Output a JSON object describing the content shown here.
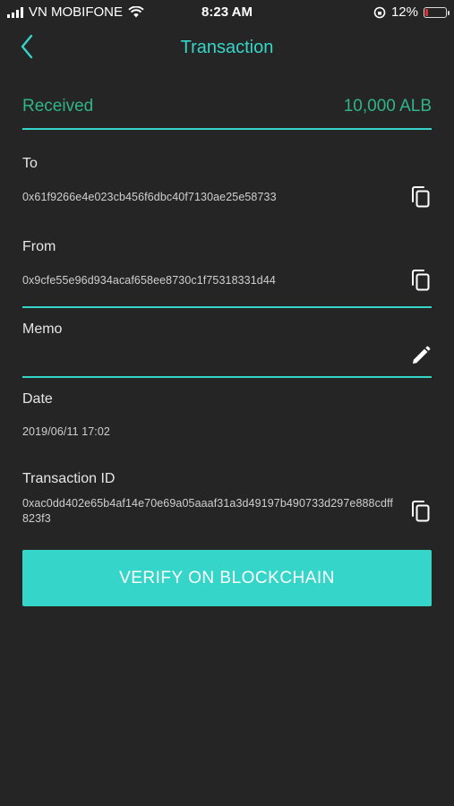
{
  "status_bar": {
    "carrier": "VN MOBIFONE",
    "time": "8:23 AM",
    "battery": "12%"
  },
  "header": {
    "title": "Transaction"
  },
  "summary": {
    "type_label": "Received",
    "amount": "10,000 ALB"
  },
  "to": {
    "label": "To",
    "address": "0x61f9266e4e023cb456f6dbc40f7130ae25e58733"
  },
  "from": {
    "label": "From",
    "address": "0x9cfe55e96d934acaf658ee8730c1f75318331d44"
  },
  "memo": {
    "label": "Memo",
    "value": ""
  },
  "date": {
    "label": "Date",
    "value": "2019/06/11 17:02"
  },
  "transaction": {
    "label": "Transaction ID",
    "id": "0xac0dd402e65b4af14e70e69a05aaaf31a3d49197b490733d297e888cdff823f3"
  },
  "actions": {
    "verify_label": "VERIFY ON BLOCKCHAIN"
  },
  "colors": {
    "accent": "#35d6c9",
    "received": "#31b489",
    "background": "#252525",
    "battery_low": "#e52b2b"
  }
}
